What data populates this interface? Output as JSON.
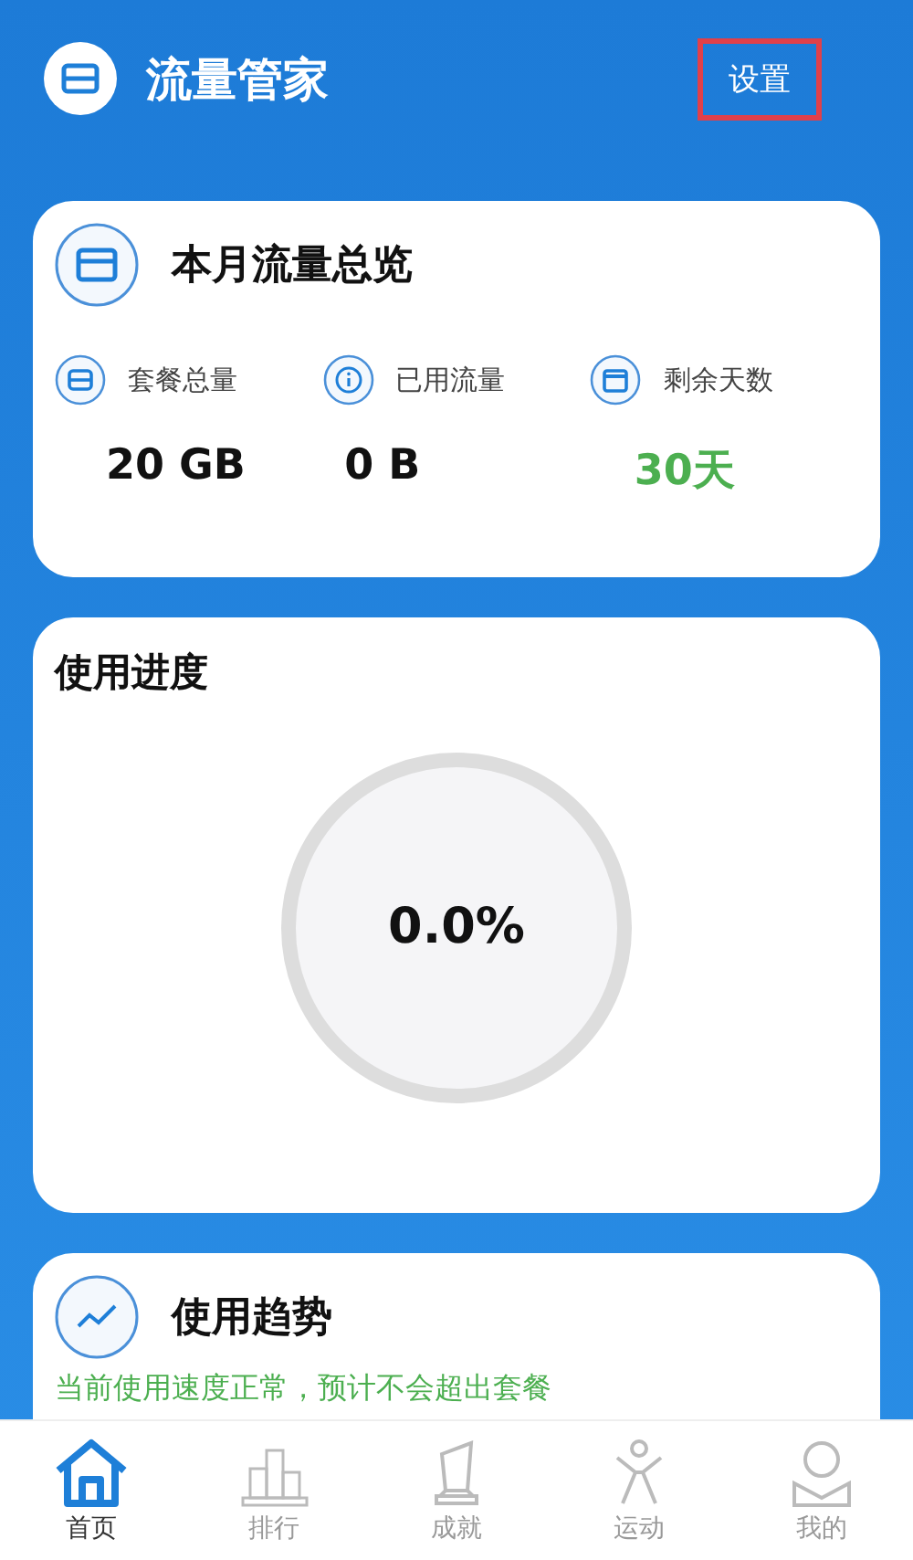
{
  "header": {
    "title": "流量管家",
    "settings_button": "设置"
  },
  "overview": {
    "title": "本月流量总览",
    "stats": [
      {
        "kind": "card",
        "label": "套餐总量",
        "value": "20 GB",
        "color": "#111111"
      },
      {
        "kind": "info",
        "label": "已用流量",
        "value": "0 B",
        "color": "#111111"
      },
      {
        "kind": "calendar",
        "label": "剩余天数",
        "value": "30天",
        "color": "#4caf50"
      }
    ]
  },
  "progress": {
    "title": "使用进度",
    "level": 0,
    "reading": "0.0%"
  },
  "trend": {
    "title": "使用趋势",
    "message": "当前使用速度正常，预计不会超出套餐"
  },
  "tabs": [
    {
      "kind": "home",
      "label": "首页",
      "selected": true
    },
    {
      "kind": "rank",
      "label": "排行",
      "selected": false
    },
    {
      "kind": "trophy",
      "label": "成就",
      "selected": false
    },
    {
      "kind": "sport",
      "label": "运动",
      "selected": false
    },
    {
      "kind": "profile",
      "label": "我的",
      "selected": false
    }
  ]
}
